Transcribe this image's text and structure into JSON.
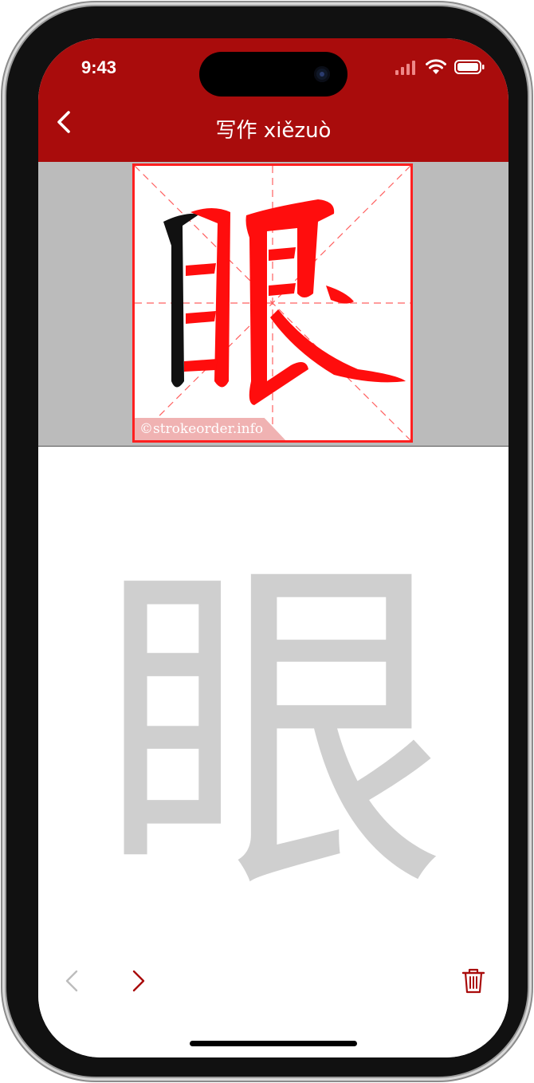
{
  "status_bar": {
    "time": "9:43"
  },
  "header": {
    "title": "写作 xiězuò"
  },
  "sample": {
    "character": "眼",
    "watermark": "©strokeorder.info"
  },
  "practice": {
    "character": "眼"
  },
  "colors": {
    "header": "#a90c0c",
    "accent": "#a90c0c",
    "guide": "#ff2020",
    "ghost": "#cfcfcf"
  },
  "icons": {
    "back": "chevron-left-icon",
    "prev": "chevron-left-icon",
    "next": "chevron-right-icon",
    "delete": "trash-icon"
  }
}
